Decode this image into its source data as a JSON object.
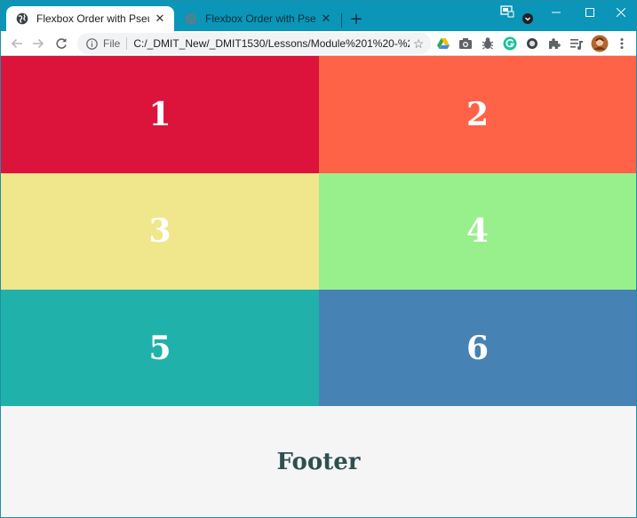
{
  "browser": {
    "tabs": [
      {
        "title": "Flexbox Order with Pseudo Selec",
        "active": true
      },
      {
        "title": "Flexbox Order with Pseudo Selec",
        "active": false
      }
    ],
    "new_tab_label": "+",
    "address": {
      "scheme": "File",
      "url": "C:/_DMIT_New/_DMIT1530/Lessons/Module%201%20-%20Re..."
    },
    "extension_icons": [
      "google-drive-icon",
      "camera-icon",
      "bug-icon",
      "grammarly-icon",
      "circle-extension-icon",
      "puzzle-icon",
      "reading-list-icon",
      "profile-avatar"
    ],
    "tab_bar_color": "#0a95b9"
  },
  "content": {
    "boxes": [
      {
        "label": "1",
        "color": "#dc143c"
      },
      {
        "label": "2",
        "color": "#ff6347"
      },
      {
        "label": "3",
        "color": "#f0e68c"
      },
      {
        "label": "4",
        "color": "#98f08c"
      },
      {
        "label": "5",
        "color": "#20b2aa"
      },
      {
        "label": "6",
        "color": "#4682b4"
      }
    ],
    "footer": {
      "label": "Footer",
      "color": "#f5f5f5",
      "text_color": "#2f4f4f"
    }
  }
}
